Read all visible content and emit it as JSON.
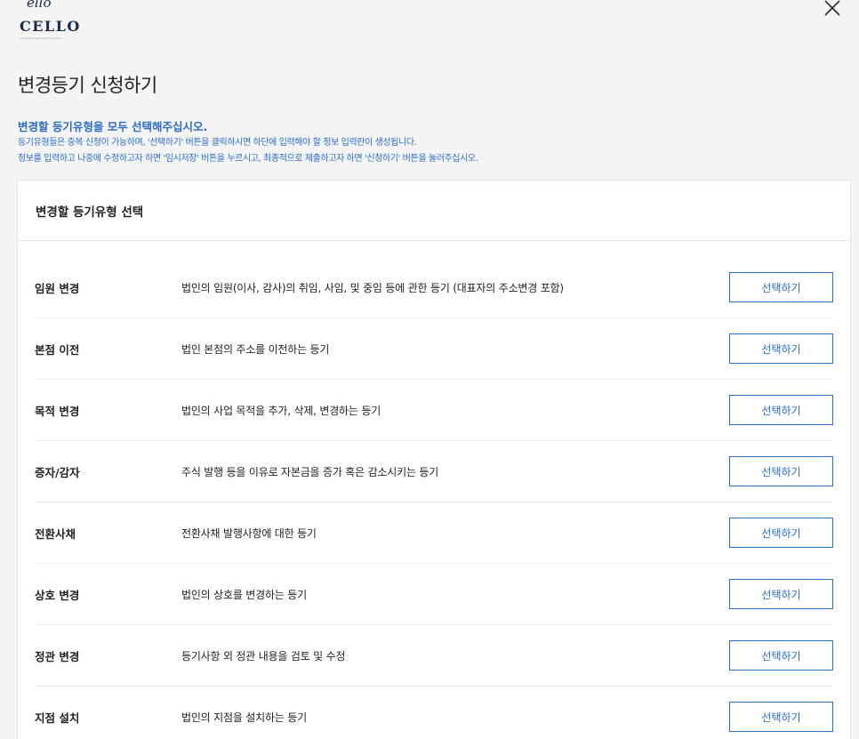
{
  "header": {
    "logo_script": "ello",
    "logo_word": "CELLO",
    "logo_tagline": "Corporate Legal Service Center",
    "close_icon": "close-icon"
  },
  "page": {
    "title": "변경등기 신청하기"
  },
  "notice": {
    "heading": "변경할 등기유형을 모두 선택해주십시오.",
    "line1": "등기유형들은 중복 신청이 가능하며, '선택하기' 버튼을 클릭하시면 하단에 입력해야 할 정보 입력란이 생성됩니다.",
    "line2": "정보를 입력하고 나중에 수정하고자 하면 '임시저장' 버튼을 누르시고, 최종적으로 제출하고자 하면 '신청하기' 버튼을 눌러주십시오."
  },
  "panel": {
    "title": "변경할 등기유형 선택",
    "rows": [
      {
        "name": "임원 변경",
        "desc": "법인의 임원(이사, 감사)의 취임, 사임, 및 중임 등에 관한 등기 (대표자의 주소변경 포함)",
        "button": "선택하기"
      },
      {
        "name": "본점 이전",
        "desc": "법인 본점의 주소를 이전하는 등기",
        "button": "선택하기"
      },
      {
        "name": "목적 변경",
        "desc": "법인의 사업 목적을 추가, 삭제, 변경하는 등기",
        "button": "선택하기"
      },
      {
        "name": "증자/감자",
        "desc": "주식 발행 등을 이유로 자본금을 증가 혹은 감소시키는 등기",
        "button": "선택하기"
      },
      {
        "name": "전환사채",
        "desc": "전환사채 발행사항에 대한 등기",
        "button": "선택하기"
      },
      {
        "name": "상호 변경",
        "desc": "법인의 상호를 변경하는 등기",
        "button": "선택하기"
      },
      {
        "name": "정관 변경",
        "desc": "등기사항 외 정관 내용을 검토 및 수정",
        "button": "선택하기"
      },
      {
        "name": "지점 설치",
        "desc": "법인의 지점을 설치하는 등기",
        "button": "선택하기"
      }
    ]
  },
  "colors": {
    "accent": "#2b6cc4",
    "brand": "#1a2a4a"
  }
}
